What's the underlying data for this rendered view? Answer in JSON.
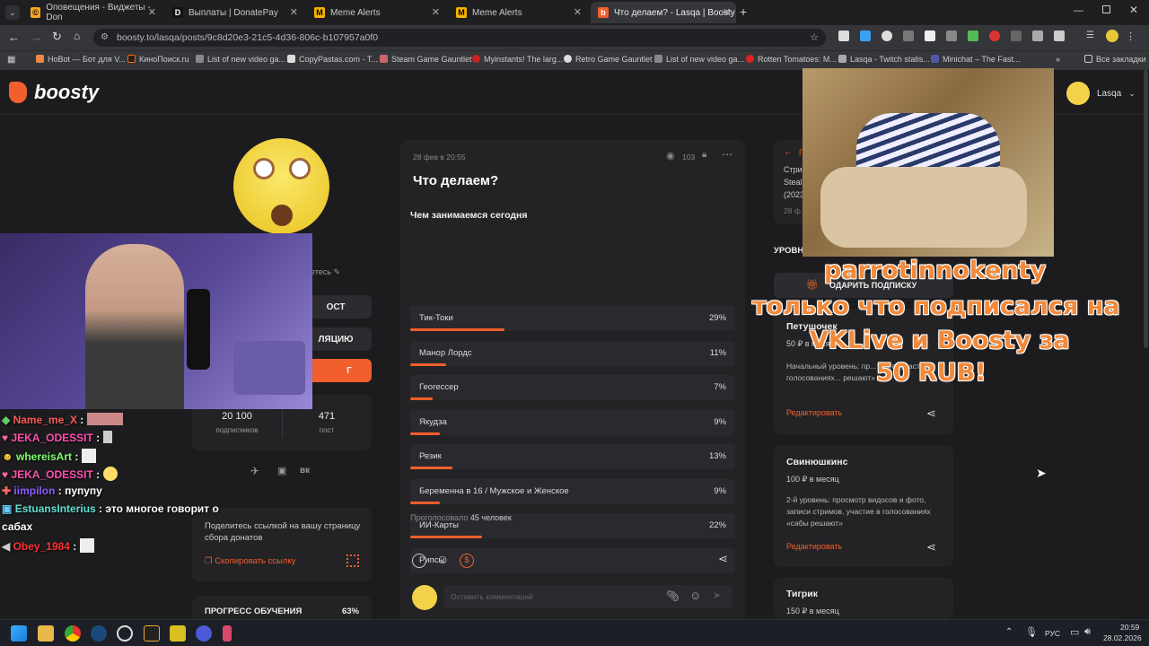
{
  "browser": {
    "tabs": [
      {
        "title": "Оповещения - Виджеты - Don",
        "icon": "donationalerts-icon",
        "color": "#f5a623"
      },
      {
        "title": "Выплаты | DonatePay",
        "icon": "donatepay-icon",
        "color": "#222"
      },
      {
        "title": "Meme Alerts",
        "icon": "memealerts-icon",
        "color": "#f5b400"
      },
      {
        "title": "Meme Alerts",
        "icon": "memealerts-icon",
        "color": "#f5b400"
      },
      {
        "title": "Что делаем? - Lasqa | Boosty",
        "icon": "boosty-icon",
        "color": "#f15f2c"
      }
    ],
    "url": "boosty.to/lasqa/posts/9c8d20e3-21c5-4d36-806c-b107957a0f0",
    "bookmarks": [
      "НоBot — Бот для V...",
      "КиноПоиск.ru",
      "List of new video ga...",
      "CopyPastas.com - T...",
      "Steam Game Gauntlet",
      "Myinstants! The larg...",
      "Retro Game Gauntlet",
      "List of new video ga...",
      "Rotten Tomatoes: M...",
      "Lasqa - Twitch statis...",
      "Minichat – The Fast..."
    ],
    "all_bookmarks": "Все закладки"
  },
  "site": {
    "logo": "boosty",
    "user": "Lasqa",
    "profile": {
      "edit_hint": "етесь",
      "btn_post": "ОСТ",
      "btn_collection": "ЛЯЦИЮ",
      "btn_blog": "Г",
      "subs_value": "20 100",
      "subs_label": "подписчиков",
      "posts_value": "471",
      "posts_label": "пост",
      "share_text": "Поделитесь ссылкой на вашу страницу сбора донатов",
      "copy_link": "Скопировать ссылку",
      "progress_label": "ПРОГРЕСС ОБУЧЕНИЯ",
      "progress_value": "63%"
    },
    "post": {
      "date": "28 фев в 20:55",
      "views": "103",
      "title": "Что делаем?",
      "poll_title": "Чем занимаемся сегодня",
      "options": [
        {
          "label": "Тик-Токи",
          "pct": "29%",
          "value": 29
        },
        {
          "label": "Манор Лордс",
          "pct": "11%",
          "value": 11
        },
        {
          "label": "Геогессер",
          "pct": "7%",
          "value": 7
        },
        {
          "label": "Якудза",
          "pct": "9%",
          "value": 9
        },
        {
          "label": "Резик",
          "pct": "13%",
          "value": 13
        },
        {
          "label": "Беременна в 16 / Мужское и Женское",
          "pct": "9%",
          "value": 9
        },
        {
          "label": "ИИ-Карты",
          "pct": "22%",
          "value": 22
        },
        {
          "label": "Рипсы",
          "pct": "",
          "value": 0
        }
      ],
      "voted_label": "Проголосовало",
      "voted_count": "45 человек",
      "comment_placeholder": "Оставить комментарий"
    },
    "right": {
      "back_label": "П",
      "item_title_1": "Стри",
      "item_title_2": "Steal",
      "item_title_3": "(2023",
      "item_date": "28 ф",
      "levels_label": "УРОВН",
      "gift_label": "ОДАРИТЬ ПОДПИСКУ",
      "tiers": [
        {
          "name": "Петушочек",
          "price": "50 ₽ в месяц",
          "desc": "Начальный уровень: пр... фото, участие в голосованиях... решают»",
          "edit": "Редактировать"
        },
        {
          "name": "Свинюшкинс",
          "price": "100 ₽ в месяц",
          "desc": "2-й уровень: просмотр видосов и фото, записи стримов, участие в голосованиях «сабы решают»",
          "edit": "Редактировать"
        },
        {
          "name": "Тигрик",
          "price": "150 ₽ в месяц"
        }
      ]
    }
  },
  "overlay": {
    "alert_line1": "parrotinnokenty",
    "alert_line2": "только что подписался на",
    "alert_line3": "VKLive и Boosty за",
    "alert_line4": "50 RUB!",
    "chat": [
      {
        "user": "Name_me_X",
        "text": "",
        "color": "#ff5a5a"
      },
      {
        "user": "JEKA_ODESSIT",
        "text": "",
        "color": "#ff4fae"
      },
      {
        "user": "whereisArt",
        "text": "",
        "color": "#7cff6b"
      },
      {
        "user": "JEKA_ODESSIT",
        "text": "",
        "color": "#ff4fae"
      },
      {
        "user": "iimpilon",
        "text": "пупупу",
        "color": "#8a5cff"
      },
      {
        "user": "EstuansInterius",
        "text": "это многое говорит о",
        "color": "#5ee0d0"
      },
      {
        "user": "",
        "text": "сабах",
        "color": "#fff"
      },
      {
        "user": "Obey_1984",
        "text": "",
        "color": "#ff3030"
      }
    ]
  },
  "taskbar": {
    "lang": "РУС",
    "time": "20:59",
    "date": "28.02.2026"
  }
}
